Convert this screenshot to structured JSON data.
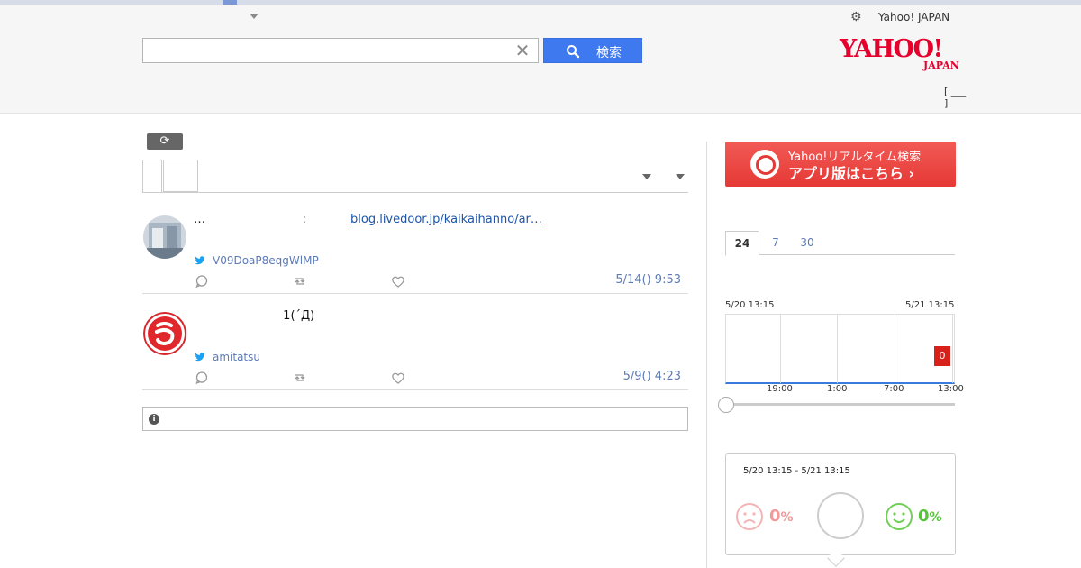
{
  "header": {
    "settings_icon": "gear-icon",
    "yahoo_link": "Yahoo! JAPAN",
    "search": {
      "value": "",
      "placeholder": "",
      "button_label": "検索"
    },
    "logo": {
      "line1": "YAHOO!",
      "line2": "JAPAN"
    },
    "bracket_text": "[ ___\n]"
  },
  "toolbar": {
    "refresh_icon": "refresh-icon"
  },
  "tweets": [
    {
      "text": "…                          :",
      "link": "blog.livedoor.jp/kaikaihanno/ar…",
      "username": "V09DoaP8eqgWlMP",
      "time": "5/14() 9:53"
    },
    {
      "text": "                        1(´Д)",
      "link": "",
      "username": "amitatsu",
      "time": "5/9() 4:23"
    }
  ],
  "sidebar": {
    "app_banner": {
      "line1": "Yahoo!リアルタイム検索",
      "line2": "アプリ版はこちら ›"
    },
    "range_tabs": [
      "24",
      "7",
      "30"
    ],
    "active_range": "24",
    "sentiment": {
      "range": "5/20 13:15 - 5/21 13:15",
      "negative": "0",
      "positive": "0",
      "unit": "%"
    }
  },
  "chart_data": {
    "type": "bar",
    "start_label": "5/20 13:15",
    "end_label": "5/21 13:15",
    "x_ticks": [
      "19:00",
      "1:00",
      "7:00",
      "13:00"
    ],
    "values": [
      0
    ],
    "value_labels": [
      "0"
    ],
    "colors": {
      "bar": "#d9211b",
      "baseline": "#3a7be0"
    }
  }
}
